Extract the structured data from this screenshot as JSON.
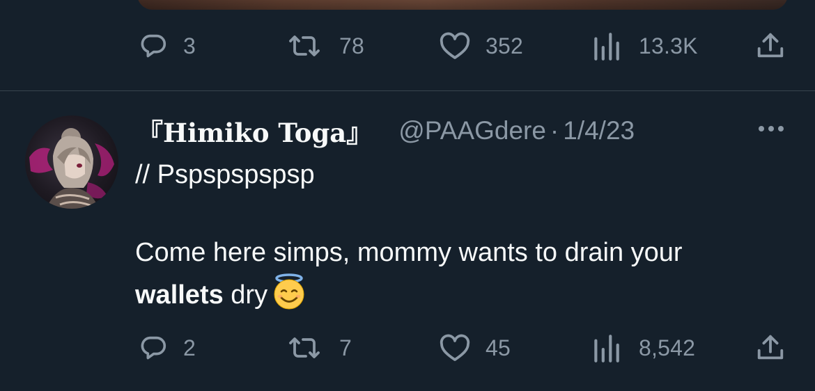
{
  "previous_tweet": {
    "actions": {
      "replies": "3",
      "retweets": "78",
      "likes": "352",
      "views": "13.3K"
    }
  },
  "tweet": {
    "display_name": "『Himiko Toga』",
    "handle": "@PAAGdere",
    "separator": "·",
    "date": "1/4/23",
    "body": {
      "line1": "// Pspspspspsp",
      "line2_text": "Come here simps, mommy wants to drain your",
      "line3_bold": "wallets",
      "line3_text": " dry"
    },
    "actions": {
      "replies": "2",
      "retweets": "7",
      "likes": "45",
      "views": "8,542"
    }
  },
  "icons": {
    "reply": "speech-bubble-icon",
    "retweet": "retweet-arrows-icon",
    "like": "heart-icon",
    "views": "bar-chart-icon",
    "share": "upload-arrow-icon",
    "more": "three-dots-icon",
    "emoji": "smiling-face-with-halo-emoji"
  },
  "colors": {
    "background": "#15202b",
    "text_primary": "#f7f9f9",
    "text_secondary": "#8b98a5",
    "divider": "#38444d"
  }
}
